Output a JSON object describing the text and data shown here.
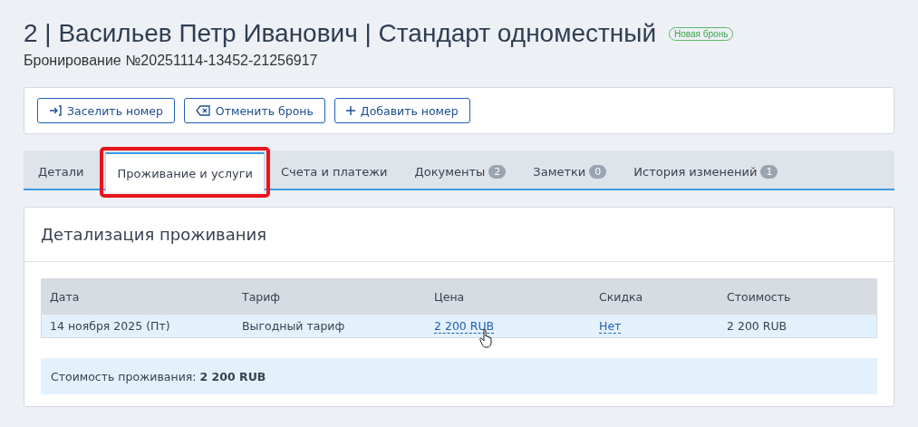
{
  "header": {
    "title": "2 | Васильев Петр Иванович | Стандарт одноместный",
    "status_badge": "Новая бронь",
    "subtitle": "Бронирование №20251114-13452-21256917"
  },
  "actions": [
    {
      "label": "Заселить номер",
      "kind": "checkin"
    },
    {
      "label": "Отменить бронь",
      "kind": "cancel"
    },
    {
      "label": "Добавить номер",
      "kind": "add"
    }
  ],
  "tabs": [
    {
      "label": "Детали",
      "selected": false
    },
    {
      "label": "Проживание и услуги",
      "selected": true,
      "highlighted": true
    },
    {
      "label": "Счета и платежи",
      "selected": false
    },
    {
      "label": "Документы",
      "count": "2",
      "selected": false
    },
    {
      "label": "Заметки",
      "count": "0",
      "selected": false
    },
    {
      "label": "История изменений",
      "count": "1",
      "selected": false
    }
  ],
  "section": {
    "title": "Детализация проживания",
    "table": {
      "columns": [
        "Дата",
        "Тариф",
        "Цена",
        "Скидка",
        "Стоимость"
      ],
      "rows": [
        {
          "cells": [
            {
              "text": "14 ноября 2025 (Пт)",
              "kind": "text"
            },
            {
              "text": "Выгодный тариф",
              "kind": "text"
            },
            {
              "text": "2 200 RUB",
              "kind": "link",
              "hovered": true
            },
            {
              "text": "Нет",
              "kind": "link"
            },
            {
              "text": "2 200 RUB",
              "kind": "text"
            }
          ]
        }
      ]
    },
    "total": "Стоимость проживания: **2 200 RUB**"
  }
}
